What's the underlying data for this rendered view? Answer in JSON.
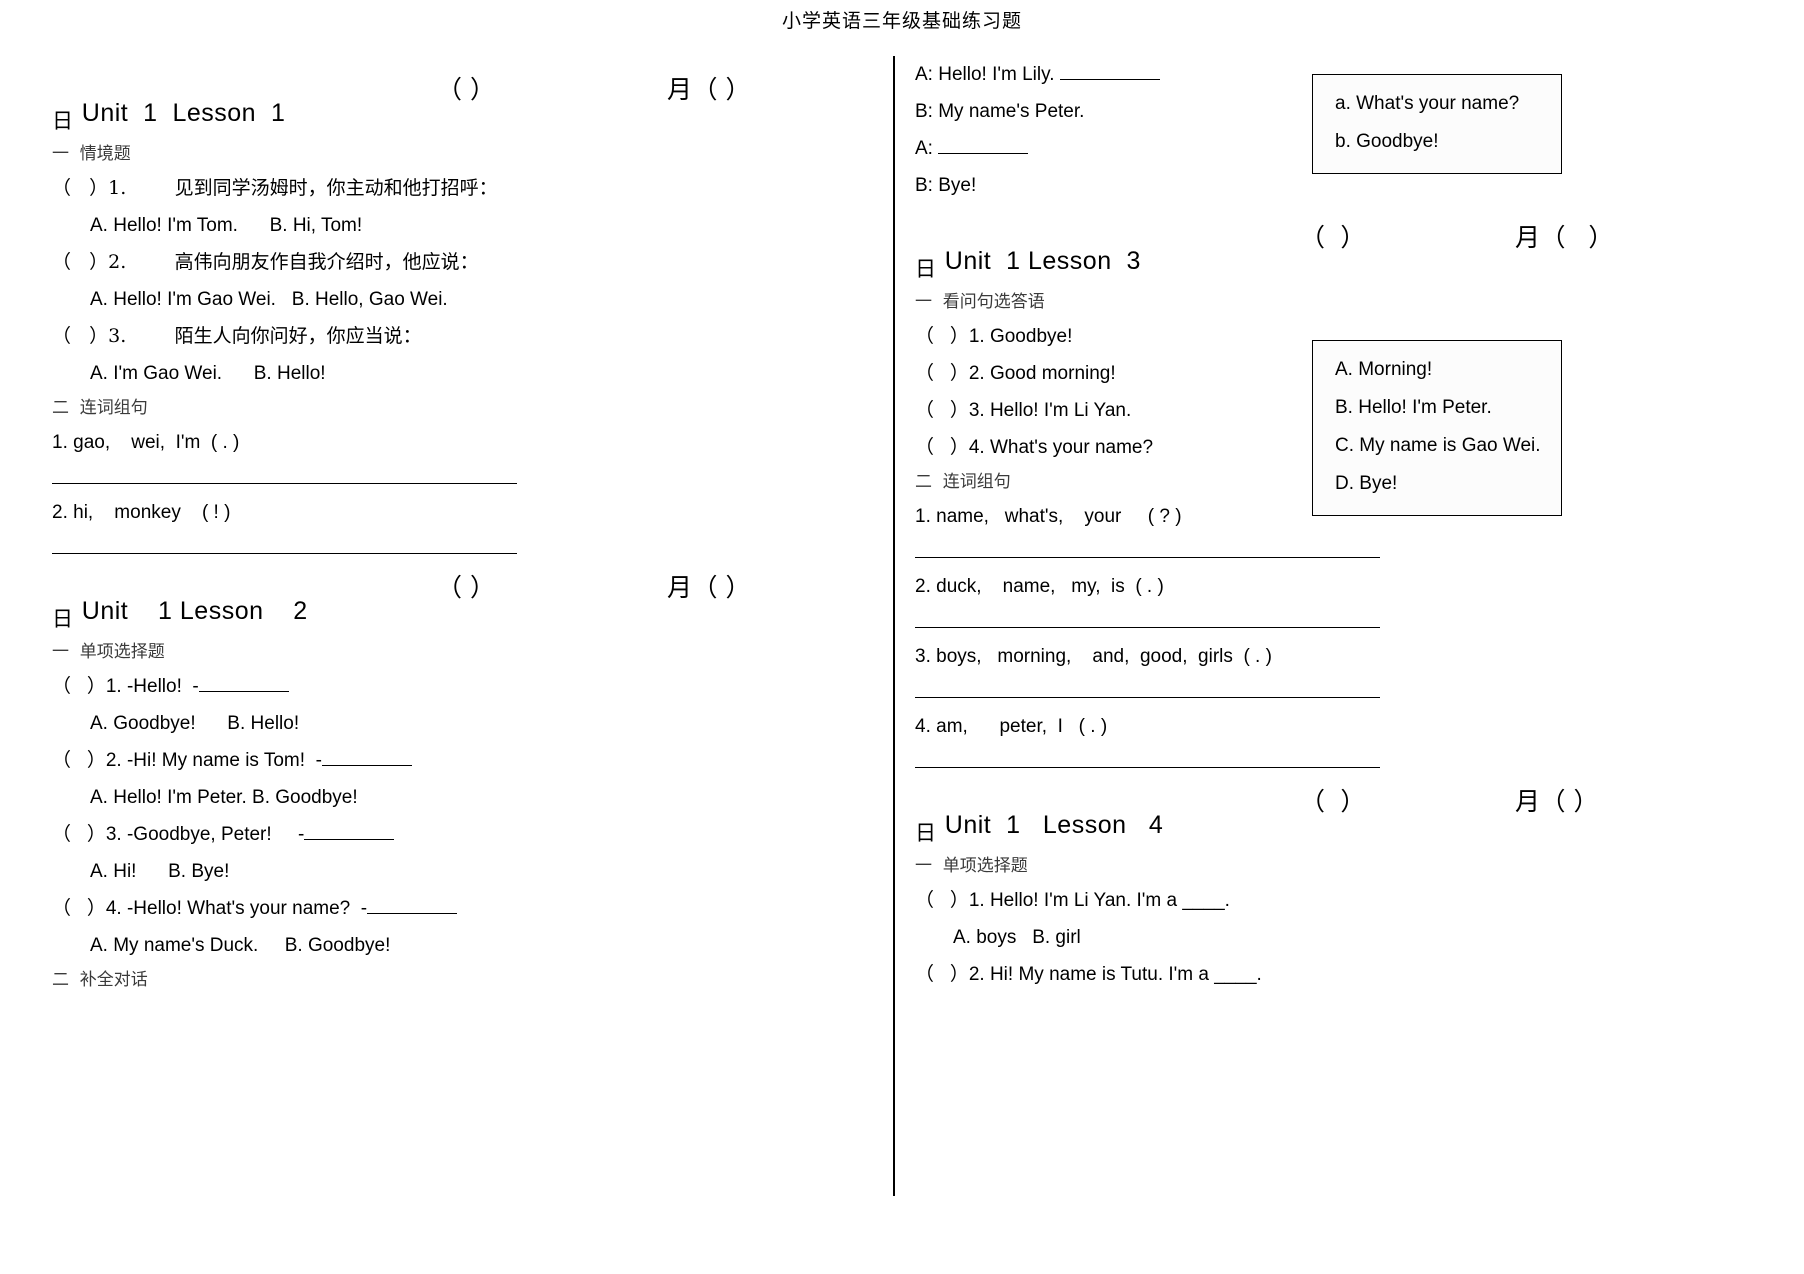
{
  "document": {
    "title": "小学英语三年级基础练习题"
  },
  "left_column": {
    "lesson1": {
      "heading": "Unit  1  Lesson  1",
      "paren": "（ ）",
      "month": "月（ ）",
      "day": "日",
      "section1_head": "一  情境题",
      "items": [
        {
          "q": "（   ）1.        见到同学汤姆时，你主动和他打招呼：",
          "opts": "A. Hello! I'm Tom.      B. Hi, Tom!"
        },
        {
          "q": "（   ）2.        高伟向朋友作自我介绍时，他应说：",
          "opts": "A. Hello! I'm Gao Wei.   B. Hello, Gao Wei."
        },
        {
          "q": "（   ）3.        陌生人向你问好，你应当说：",
          "opts": "A. I'm Gao Wei.      B. Hello!"
        }
      ],
      "section2_head": "二  连词组句",
      "word_order": [
        "1. gao,    wei,  I'm  ( . )",
        "2. hi,    monkey    ( ! )"
      ]
    },
    "lesson2": {
      "heading": "Unit    1 Lesson    2",
      "paren": "（ ）",
      "month": "月（ ）",
      "day": "日",
      "section1_head": "一  单项选择题",
      "items": [
        {
          "q_pre": "（   ）1. -Hello!  -",
          "q_post": "",
          "opts": "A. Goodbye!      B. Hello!"
        },
        {
          "q_pre": "（   ）2. -Hi! My name is Tom!  -",
          "q_post": "",
          "opts": "A. Hello! I'm Peter. B. Goodbye!"
        },
        {
          "q_pre": "（   ）3. -Goodbye, Peter!     -",
          "q_post": "",
          "opts": "A. Hi!      B. Bye!"
        },
        {
          "q_pre": "（   ）4. -Hello! What's your name?  -",
          "q_post": "",
          "opts": "A. My name's Duck.     B. Goodbye!"
        }
      ],
      "section2_head": "二  补全对话"
    }
  },
  "right_column": {
    "dialogue": {
      "line_a1_pre": "A: Hello! I'm Lily. ",
      "line_b1": "B: My name's Peter.",
      "line_a2_pre": "A: ",
      "line_b2": "B: Bye!"
    },
    "answer_box_1": {
      "lines": [
        "a. What's your name?",
        "b. Goodbye!"
      ]
    },
    "lesson3": {
      "heading": "Unit  1 Lesson  3",
      "paren": "（  ）",
      "month": "月（   ）",
      "day": "日",
      "section1_head": "一  看问句选答语",
      "items": [
        "（   ）1. Goodbye!",
        "（   ）2. Good morning!",
        "（   ）3. Hello! I'm Li Yan.",
        "（   ）4. What's your name?"
      ],
      "section2_head": "二  连词组句",
      "word_order": [
        "1. name,   what's,    your     ( ? )",
        "2. duck,    name,   my,  is  ( . )",
        "3. boys,   morning,    and,  good,  girls  ( . )",
        "4. am,      peter,  I   ( . )"
      ]
    },
    "answer_box_2": {
      "lines": [
        "A. Morning!",
        "B. Hello! I'm Peter.",
        "C. My name is Gao Wei.",
        "D. Bye!"
      ]
    },
    "lesson4": {
      "heading": "Unit  1   Lesson   4",
      "paren": "（  ）",
      "month": "月（ ）",
      "day": "日",
      "section1_head": "一  单项选择题",
      "items": [
        {
          "q": "（   ）1. Hello! I'm Li Yan. I'm a ____.",
          "opts": "A. boys   B. girl"
        },
        {
          "q": "（   ）2. Hi! My name is Tutu. I'm a ____.",
          "opts": ""
        }
      ]
    }
  }
}
